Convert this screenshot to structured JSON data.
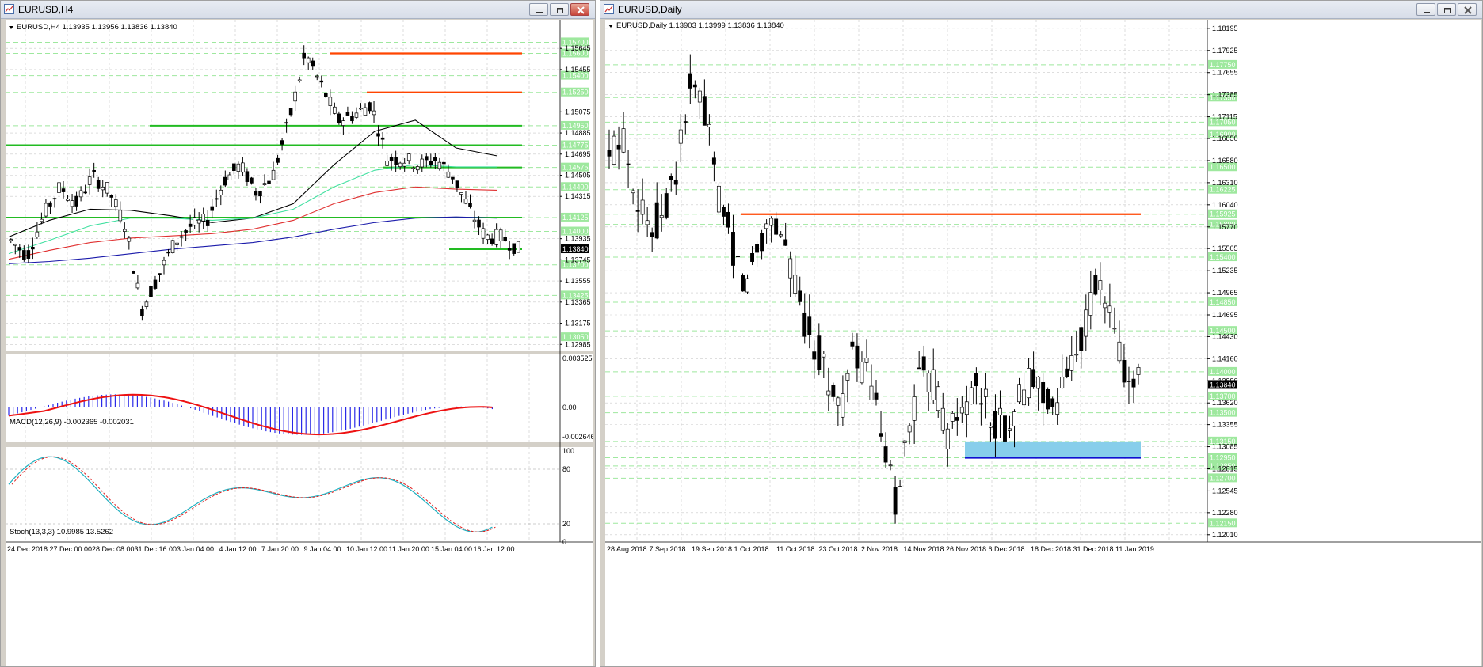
{
  "colors": {
    "bull_candle": "#ffffff",
    "bear_candle": "#000000",
    "grid": "#c9c9c9",
    "green_level": "#22bb22",
    "label_green": "#9ee89e",
    "res_red": "#ff4500",
    "ma_black": "#000000",
    "ma_teal": "#40e0a0",
    "ma_red": "#e03030",
    "ma_blue": "#1a1aaa",
    "macd_hist": "#2a2ae8",
    "macd_signal": "#ee1111",
    "stoch_main": "#20b0c0",
    "stoch_signal": "#e02020",
    "support_zone": "#87ceeb",
    "support_line": "#1010d0",
    "current_price_bg": "#000000"
  },
  "left": {
    "title": "EURUSD,H4",
    "header": "EURUSD,H4  1.13935 1.13956 1.13836 1.13840",
    "price_ticks": [
      "1.15645",
      "1.15455",
      "1.15075",
      "1.14885",
      "1.14695",
      "1.14505",
      "1.14315",
      "1.13935",
      "1.13745",
      "1.13555",
      "1.13365",
      "1.13175",
      "1.12985"
    ],
    "level_labels": [
      "1.15700",
      "1.15600",
      "1.15400",
      "1.15250",
      "1.14950",
      "1.14775",
      "1.14575",
      "1.14400",
      "1.14125",
      "1.14000",
      "1.13700",
      "1.13425",
      "1.13050"
    ],
    "current_price": "1.13840",
    "resistance_levels": [
      1.156,
      1.1525
    ],
    "green_levels": [
      1.1495,
      1.14775,
      1.14575,
      1.14125,
      1.1384
    ],
    "macd_label": "MACD(12,26,9) -0.002365 -0.002031",
    "macd_ticks": [
      "0.003525",
      "0.00",
      "-0.002646"
    ],
    "stoch_label": "Stoch(13,3,3) 10.9985 13.5262",
    "stoch_ticks": [
      "100",
      "80",
      "20",
      "0"
    ],
    "time_labels": [
      "24 Dec 2018",
      "27 Dec 00:00",
      "28 Dec 08:00",
      "31 Dec 16:00",
      "3 Jan 04:00",
      "4 Jan 12:00",
      "7 Jan 20:00",
      "9 Jan 04:00",
      "10 Jan 12:00",
      "11 Jan 20:00",
      "15 Jan 04:00",
      "16 Jan 12:00"
    ]
  },
  "right": {
    "title": "EURUSD,Daily",
    "header": "EURUSD,Daily  1.13903 1.13999 1.13836 1.13840",
    "price_ticks": [
      "1.18195",
      "1.17925",
      "1.17655",
      "1.17385",
      "1.17115",
      "1.16850",
      "1.16580",
      "1.16310",
      "1.16040",
      "1.15770",
      "1.15505",
      "1.15235",
      "1.14965",
      "1.14695",
      "1.14430",
      "1.14160",
      "1.13890",
      "1.13620",
      "1.13355",
      "1.13085",
      "1.12815",
      "1.12545",
      "1.12280",
      "1.12010"
    ],
    "level_labels": [
      "1.17750",
      "1.17350",
      "1.17050",
      "1.16900",
      "1.16500",
      "1.16225",
      "1.15925",
      "1.15800",
      "1.15400",
      "1.14850",
      "1.14500",
      "1.14000",
      "1.13700",
      "1.13500",
      "1.13150",
      "1.12950",
      "1.12850",
      "1.12700",
      "1.12150"
    ],
    "current_price": "1.13840",
    "resistance_level": 1.15925,
    "support_zone": [
      1.1295,
      1.1315
    ],
    "time_labels": [
      "28 Aug 2018",
      "7 Sep 2018",
      "19 Sep 2018",
      "1 Oct 2018",
      "11 Oct 2018",
      "23 Oct 2018",
      "2 Nov 2018",
      "14 Nov 2018",
      "26 Nov 2018",
      "6 Dec 2018",
      "18 Dec 2018",
      "31 Dec 2018",
      "11 Jan 2019"
    ]
  }
}
